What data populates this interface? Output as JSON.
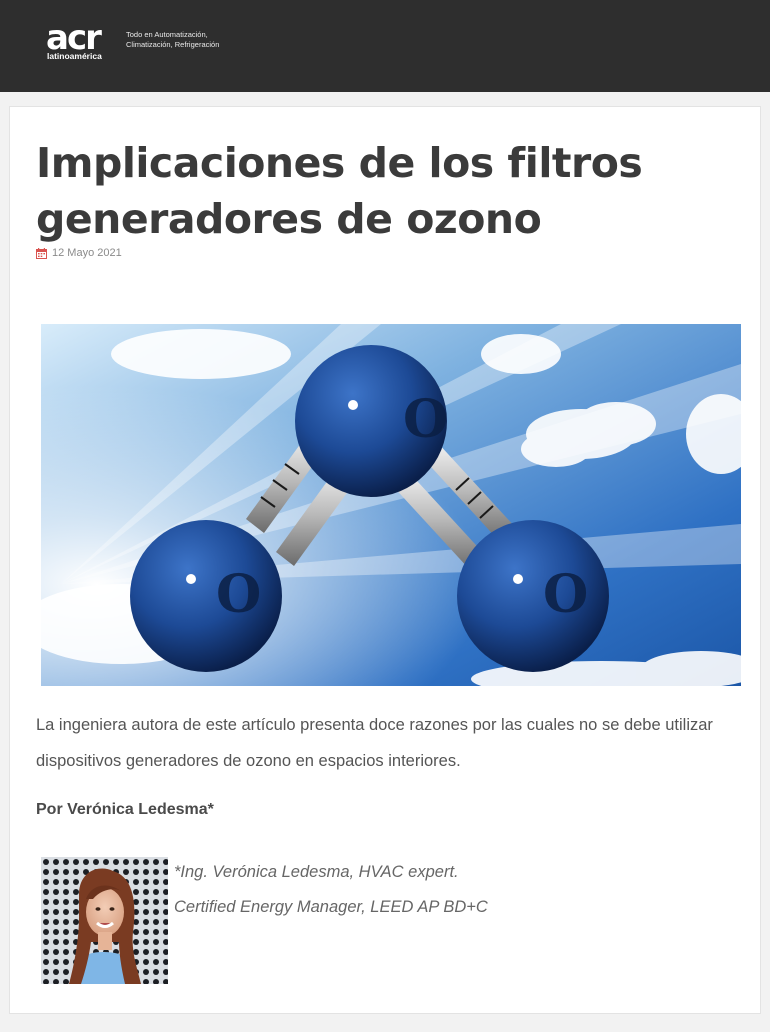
{
  "header": {
    "logo_text": "acr",
    "logo_sub": "latinoamérica",
    "tagline_1": "Todo en Automatización,",
    "tagline_2": "Climatización, Refrigeración"
  },
  "article": {
    "title": "Implicaciones de los filtros generadores de ozono",
    "date": "12 Mayo 2021",
    "lead": "La ingeniera autora de este artículo presenta doce razones por las cuales no se debe utilizar dispositivos generadores de ozono en espacios interiores.",
    "byline": "Por Verónica Ledesma*",
    "author_note_1": "*Ing. Verónica Ledesma, HVAC expert.",
    "author_note_2": "Certified Energy Manager, LEED AP BD+C"
  },
  "hero": {
    "atom_label": "O"
  },
  "colors": {
    "topbar": "#2e2e2e",
    "date_icon": "#d9534f",
    "atom": "#1f4f9e"
  }
}
